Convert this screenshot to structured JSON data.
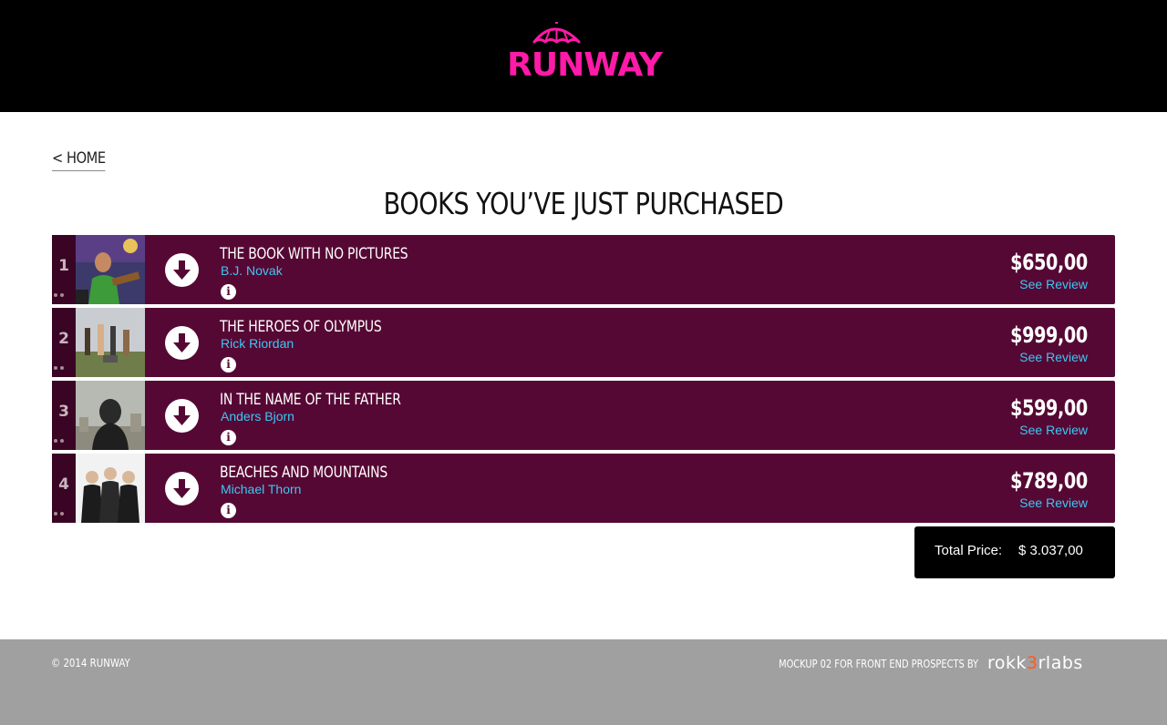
{
  "header": {
    "logo_text": "RUNWAY",
    "logo_color": "#ff1aa8"
  },
  "nav": {
    "home_link": "< HOME"
  },
  "page_title": "BOOKS YOU’VE JUST PURCHASED",
  "books": [
    {
      "rank": "1",
      "title": "THE BOOK WITH NO PICTURES",
      "author": "B.J. Novak",
      "price": "$650,00",
      "review_label": "See Review",
      "info_icon": "i"
    },
    {
      "rank": "2",
      "title": "THE HEROES OF OLYMPUS",
      "author": "Rick Riordan",
      "price": "$999,00",
      "review_label": "See Review",
      "info_icon": "i"
    },
    {
      "rank": "3",
      "title": "IN THE NAME OF THE FATHER",
      "author": "Anders Bjorn",
      "price": "$599,00",
      "review_label": "See Review",
      "info_icon": "i"
    },
    {
      "rank": "4",
      "title": "BEACHES AND MOUNTAINS",
      "author": "Michael Thorn",
      "price": "$789,00",
      "review_label": "See Review",
      "info_icon": "i"
    }
  ],
  "total": {
    "label": "Total Price:",
    "value": "$ 3.037,00"
  },
  "footer": {
    "copyright": "© 2014 RUNWAY",
    "credit": "MOCKUP 02 FOR FRONT END PROSPECTS BY",
    "brand_pre": "rokk",
    "brand_mid": "3",
    "brand_post": "rlabs"
  },
  "colors": {
    "row_bg": "#560834",
    "link": "#3dc7f3",
    "footer_bg": "#a0a0a0"
  }
}
